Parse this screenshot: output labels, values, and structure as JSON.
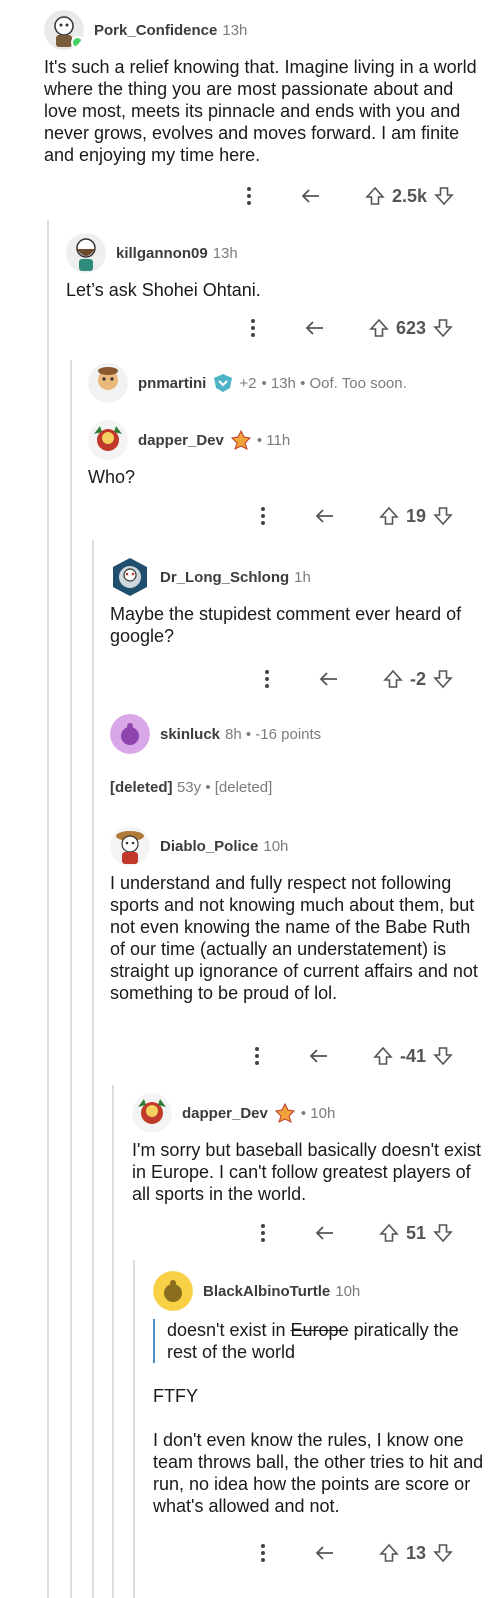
{
  "comments": [
    {
      "user": "Pork_Confidence",
      "time": "13h",
      "text": "It's such a relief knowing that. Imagine living in a world where the thing you are most passionate about and love most, meets its pinnacle and ends with you and never grows, evolves and moves forward. I am finite and enjoying my time here.",
      "votes": "2.5k"
    },
    {
      "user": "killgannon09",
      "time": "13h",
      "text": "Let’s ask Shohei Ohtani.",
      "votes": "623"
    },
    {
      "user": "pnmartini",
      "extra": "+2",
      "meta_after": "• 13h • Oof. Too soon."
    },
    {
      "user": "dapper_Dev",
      "time": "• 11h",
      "text": "Who?",
      "votes": "19"
    },
    {
      "user": "Dr_Long_Schlong",
      "time": "1h",
      "text": "Maybe the stupidest comment ever heard of google?",
      "votes": "-2"
    },
    {
      "user": "skinluck",
      "time": "8h • -16 points"
    },
    {
      "user": "[deleted]",
      "time": "53y • [deleted]"
    },
    {
      "user": "Diablo_Police",
      "time": "10h",
      "text": "I understand and fully respect not following sports and not knowing much about them, but not even knowing the name of the Babe Ruth of our time (actually an understatement) is straight up ignorance of current affairs and not something to be proud of lol.",
      "votes": "-41"
    },
    {
      "user": "dapper_Dev",
      "time": "• 10h",
      "text": "I'm sorry but baseball basically doesn't exist in Europe. I can't follow greatest players of all sports in the world.",
      "votes": "51"
    },
    {
      "user": "BlackAlbinoTurtle",
      "time": "10h",
      "quote_pre": "doesn't exist in ",
      "quote_strike": "Europe",
      "quote_post": " piratically the rest of the world",
      "p1": "FTFY",
      "p2": "I don't even know the rules, I know one team throws ball, the other tries to hit and run, no idea how the points are score or what's allowed and not.",
      "votes": "13"
    }
  ],
  "icons": {
    "more": "more-options-icon",
    "reply": "reply-icon",
    "up": "upvote-icon",
    "down": "downvote-icon"
  },
  "colors": {
    "online": "#46d160",
    "quote_bar": "#4a90c8",
    "thread_line": "#dcdcdc"
  }
}
